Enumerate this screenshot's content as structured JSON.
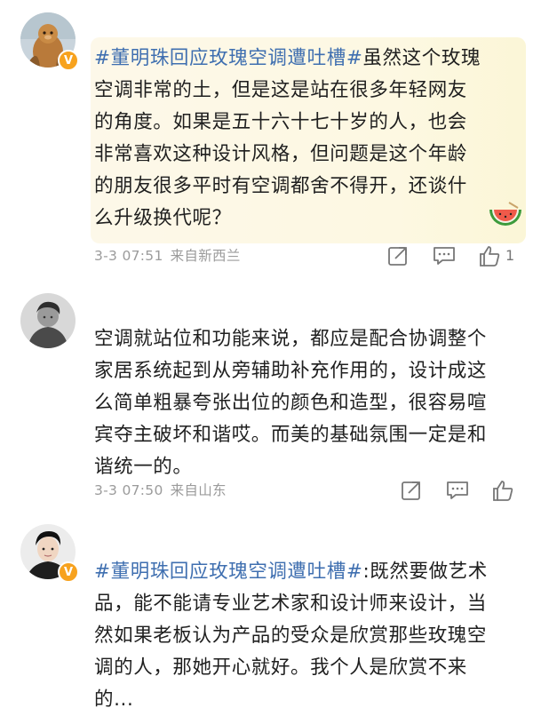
{
  "comments": [
    {
      "hashtag": "#董明珠回应玫瑰空调遭吐槽#",
      "text_lines": [
        "虽然这个玫瑰",
        "空调非常的土，但是这是站在很多年轻网友",
        "的角度。如果是五十六十七十岁的人，也会",
        "非常喜欢这种设计风格，但问题是这个年龄",
        "的朋友很多平时有空调都舍不得开，还谈什",
        "么升级换代呢？"
      ],
      "time": "3-3 07:51",
      "source": "来自新西兰",
      "like_count": "1",
      "verified_badge": "V",
      "icons": [
        "share-icon",
        "comment-icon",
        "like-icon",
        "watermelon-badge-icon"
      ]
    },
    {
      "hashtag": "",
      "text_lines": [
        "空调就站位和功能来说，都应是配合协调整个",
        "家居系统起到从旁辅助补充作用的，设计成这",
        "么简单粗暴夸张出位的颜色和造型，很容易喧",
        "宾夺主破坏和谐哎。而美的基础氛围一定是和",
        "谐统一的。"
      ],
      "time": "3-3 07:50",
      "source": "来自山东",
      "like_count": "",
      "icons": [
        "share-icon",
        "comment-icon",
        "like-icon"
      ]
    },
    {
      "hashtag": "#董明珠回应玫瑰空调遭吐槽#",
      "text_lines": [
        ":既然要做艺术",
        "品，能不能请专业艺术家和设计师来设计，当",
        "然如果老板认为产品的受众是欣赏那些玫瑰空",
        "调的人，那她开心就好。我个人是欣赏不来",
        "的..."
      ],
      "verified_badge": "V"
    }
  ],
  "colors": {
    "hashtag": "#3f6fb0",
    "meta": "#9b9b9b",
    "verified": "#f7a21e",
    "highlight_bg": "#fdf8e9"
  }
}
